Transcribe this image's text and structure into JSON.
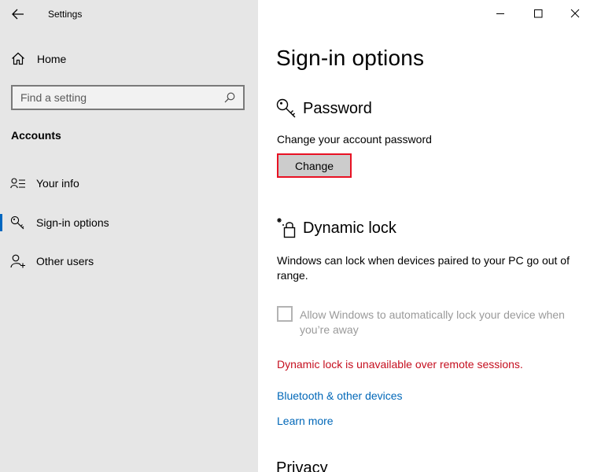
{
  "window": {
    "app_title": "Settings",
    "controls": [
      "minimize-icon",
      "maximize-icon",
      "close-icon"
    ]
  },
  "sidebar": {
    "home_label": "Home",
    "search": {
      "placeholder": "Find a setting"
    },
    "section_title": "Accounts",
    "items": [
      {
        "label": "Your info",
        "icon": "person-card-icon",
        "selected": false
      },
      {
        "label": "Sign-in options",
        "icon": "key-icon",
        "selected": true
      },
      {
        "label": "Other users",
        "icon": "person-add-icon",
        "selected": false
      }
    ]
  },
  "main": {
    "page_title": "Sign-in options",
    "password": {
      "title": "Password",
      "description": "Change your account password",
      "button_label": "Change"
    },
    "dynamic_lock": {
      "title": "Dynamic lock",
      "description": "Windows can lock when devices paired to your PC go out of range.",
      "checkbox_label": "Allow Windows to automatically lock your device when you’re away",
      "checkbox_checked": false,
      "warning": "Dynamic lock is unavailable over remote sessions.",
      "links": [
        "Bluetooth & other devices",
        "Learn more"
      ]
    },
    "next_section_title": "Privacy"
  },
  "colors": {
    "sidebar_bg": "#e6e6e6",
    "accent": "#0067c0",
    "link": "#0067b8",
    "warning": "#c50f1f",
    "focus_border": "#e81123"
  }
}
